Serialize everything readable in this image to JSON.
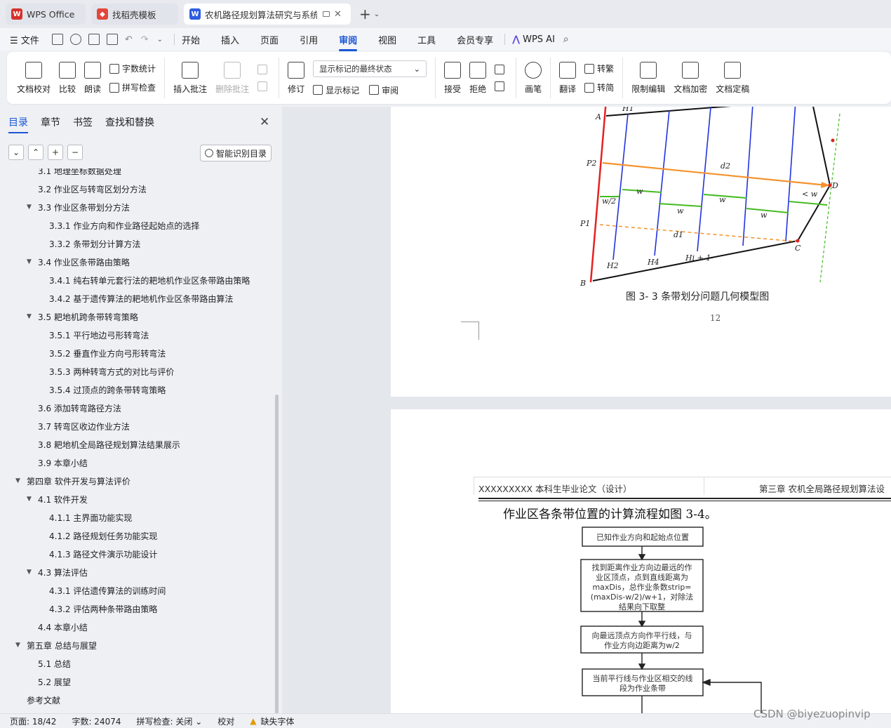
{
  "tabs": [
    {
      "label": "WPS Office",
      "color": "#d6322d"
    },
    {
      "label": "找稻壳模板",
      "color": "#e2463b"
    },
    {
      "label": "农机路径规划算法研究与系统",
      "color": "#2d5de0"
    }
  ],
  "menu": {
    "file": "文件",
    "items": [
      "开始",
      "插入",
      "页面",
      "引用",
      "审阅",
      "视图",
      "工具",
      "会员专享"
    ],
    "active": "审阅",
    "ai": "WPS AI"
  },
  "ribbon": {
    "doc_check": "文档校对",
    "compare": "比较",
    "read": "朗读",
    "word_count": "字数统计",
    "spell_check": "拼写检查",
    "insert_comment": "插入批注",
    "delete_comment": "删除批注",
    "revise": "修订",
    "markup_dropdown": "显示标记的最终状态",
    "show_markup": "显示标记",
    "review": "审阅",
    "accept": "接受",
    "reject": "拒绝",
    "pen": "画笔",
    "translate": "翻译",
    "to_traditional": "转繁",
    "to_simplified": "转简",
    "restrict_edit": "限制编辑",
    "encrypt": "文档加密",
    "finalize": "文档定稿"
  },
  "sidebar": {
    "tabs": [
      "目录",
      "章节",
      "书签",
      "查找和替换"
    ],
    "smart_toc": "智能识别目录",
    "toc": [
      {
        "label": "3.1 地理坐标数据处理",
        "level": 2,
        "arrow": ""
      },
      {
        "label": "3.2 作业区与转弯区划分方法",
        "level": 2,
        "arrow": ""
      },
      {
        "label": "3.3 作业区条带划分方法",
        "level": 2,
        "arrow": "▼"
      },
      {
        "label": "3.3.1 作业方向和作业路径起始点的选择",
        "level": 3,
        "arrow": ""
      },
      {
        "label": "3.3.2 条带划分计算方法",
        "level": 3,
        "arrow": ""
      },
      {
        "label": "3.4 作业区条带路由策略",
        "level": 2,
        "arrow": "▼"
      },
      {
        "label": "3.4.1 纯右转单元套行法的耙地机作业区条带路由策略",
        "level": 3,
        "arrow": ""
      },
      {
        "label": "3.4.2 基于遗传算法的耙地机作业区条带路由算法",
        "level": 3,
        "arrow": ""
      },
      {
        "label": "3.5 耙地机跨条带转弯策略",
        "level": 2,
        "arrow": "▼"
      },
      {
        "label": "3.5.1 平行地边弓形转弯法",
        "level": 3,
        "arrow": ""
      },
      {
        "label": "3.5.2 垂直作业方向弓形转弯法",
        "level": 3,
        "arrow": ""
      },
      {
        "label": "3.5.3 两种转弯方式的对比与评价",
        "level": 3,
        "arrow": ""
      },
      {
        "label": "3.5.4 过顶点的跨条带转弯策略",
        "level": 3,
        "arrow": ""
      },
      {
        "label": "3.6 添加转弯路径方法",
        "level": 2,
        "arrow": ""
      },
      {
        "label": "3.7 转弯区收边作业方法",
        "level": 2,
        "arrow": ""
      },
      {
        "label": "3.8 耙地机全局路径规划算法结果展示",
        "level": 2,
        "arrow": ""
      },
      {
        "label": "3.9 本章小结",
        "level": 2,
        "arrow": ""
      },
      {
        "label": "第四章  软件开发与算法评价",
        "level": 1,
        "arrow": "▼"
      },
      {
        "label": "4.1 软件开发",
        "level": 2,
        "arrow": "▼"
      },
      {
        "label": "4.1.1 主界面功能实现",
        "level": 3,
        "arrow": ""
      },
      {
        "label": "4.1.2 路径规划任务功能实现",
        "level": 3,
        "arrow": ""
      },
      {
        "label": "4.1.3 路径文件演示功能设计",
        "level": 3,
        "arrow": ""
      },
      {
        "label": "4.3 算法评估",
        "level": 2,
        "arrow": "▼"
      },
      {
        "label": "4.3.1 评估遗传算法的训练时间",
        "level": 3,
        "arrow": ""
      },
      {
        "label": "4.3.2 评估两种条带路由策略",
        "level": 3,
        "arrow": ""
      },
      {
        "label": "4.4 本章小结",
        "level": 2,
        "arrow": ""
      },
      {
        "label": "第五章  总结与展望",
        "level": 1,
        "arrow": "▼"
      },
      {
        "label": "5.1 总结",
        "level": 2,
        "arrow": ""
      },
      {
        "label": "5.2 展望",
        "level": 2,
        "arrow": ""
      },
      {
        "label": "参考文献",
        "level": 1,
        "arrow": ""
      }
    ]
  },
  "page1": {
    "labels": {
      "A": "A",
      "B": "B",
      "C": "C",
      "D": "D",
      "P1": "P1",
      "P2": "P2",
      "H1": "H1",
      "H2": "H2",
      "H4": "H4",
      "Hi1": "Hi + 1",
      "d1": "d1",
      "d2": "d2",
      "w": "w",
      "w2": "w/2",
      "ltw": "< w"
    },
    "caption": "图 3- 3  条带划分问题几何模型图",
    "page_number": "12"
  },
  "page2": {
    "header_left": "XXXXXXXXX 本科生毕业论文（设计）",
    "header_right": "第三章  农机全局路径规划算法设",
    "paragraph": "作业区各条带位置的计算流程如图 3-4。",
    "flow": {
      "box1": "已知作业方向和起始点位置",
      "box2": [
        "找到距离作业方向边最远的作",
        "业区顶点，点到直线距离为",
        "maxDis，总作业条数strip=",
        "(maxDis-w/2)/w+1，对除法",
        "结果向下取整"
      ],
      "box3": [
        "向最远顶点方向作平行线，与",
        "作业方向边距离为w/2"
      ],
      "box4": [
        "当前平行线与作业区相交的线",
        "段为作业条带"
      ]
    }
  },
  "status": {
    "page": "页面: 18/42",
    "words": "字数: 24074",
    "spell": "拼写检查: 关闭",
    "proof": "校对",
    "missing_font": "缺失字体"
  },
  "watermark": "CSDN @biyezuopinvip"
}
